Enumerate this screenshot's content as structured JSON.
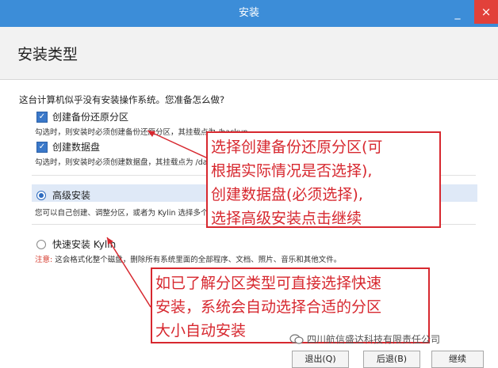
{
  "window": {
    "title": "安装",
    "minimize_glyph": "_",
    "close_glyph": "×"
  },
  "header": {
    "page_title": "安装类型"
  },
  "content": {
    "question": "这台计算机似乎没有安装操作系统。您准备怎么做?",
    "options": {
      "backup": {
        "label": "创建备份还原分区",
        "checked": true,
        "desc": "勾选时，则安装时必须创建备份还原分区，其挂载点为 /backup"
      },
      "data": {
        "label": "创建数据盘",
        "checked": true,
        "desc": "勾选时，则安装时必须创建数据盘，其挂载点为 /data，其大小至少为所剩可用空间大小。"
      },
      "advanced": {
        "label": "高级安装",
        "selected": true,
        "desc": "您可以自己创建、调整分区，或者为 Kylin 选择多个分区。"
      },
      "quick": {
        "label": "快速安装 Kylin",
        "selected": false,
        "warn_prefix": "注意:",
        "desc": "这会格式化整个磁盘，删除所有系统里面的全部程序、文档、照片、音乐和其他文件。"
      }
    }
  },
  "callouts": {
    "first": {
      "line1": "选择创建备份还原分区(可",
      "line2": "根据实际情况是否选择),",
      "line3": "创建数据盘(必须选择),",
      "line4": "选择高级安装点击继续"
    },
    "second": {
      "line1": "如已了解分区类型可直接选择快速",
      "line2": "安装，系统会自动选择合适的分区",
      "line3": "大小自动安装"
    }
  },
  "buttons": {
    "quit": "退出(Q)",
    "back": "后退(B)",
    "continue": "继续"
  },
  "watermark": {
    "text": "四川航信盛达科技有限责任公司"
  },
  "colors": {
    "titlebar": "#3c8dd8",
    "close": "#e2413a",
    "callout": "#d7282f",
    "accent": "#2d6bbf"
  }
}
